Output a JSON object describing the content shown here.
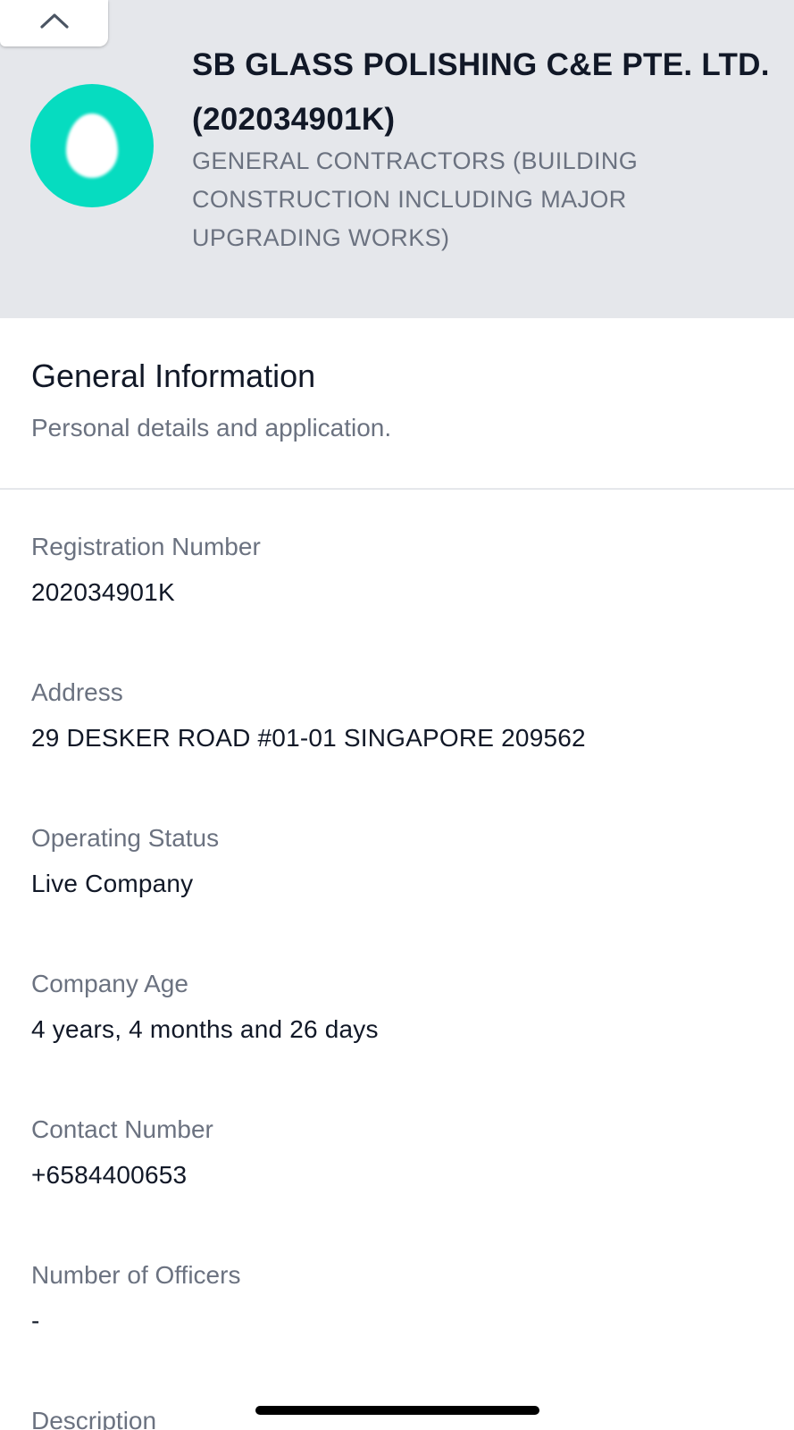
{
  "header": {
    "company_name": "SB GLASS POLISHING C&E PTE. LTD. (202034901K)",
    "category": "GENERAL CONTRACTORS (BUILDING CONSTRUCTION INCLUDING MAJOR UPGRADING WORKS)",
    "logo_color": "#06dcc0",
    "collapse_icon": "chevron-up-icon"
  },
  "section": {
    "title": "General Information",
    "subtitle": "Personal details and application."
  },
  "fields": [
    {
      "label": "Registration Number",
      "value": "202034901K"
    },
    {
      "label": "Address",
      "value": "29 DESKER ROAD #01-01 SINGAPORE 209562"
    },
    {
      "label": "Operating Status",
      "value": "Live Company"
    },
    {
      "label": "Company Age",
      "value": "4 years, 4 months and 26 days"
    },
    {
      "label": "Contact Number",
      "value": "+6584400653"
    },
    {
      "label": "Number of Officers",
      "value": "-"
    },
    {
      "label": "Description",
      "value": ""
    }
  ]
}
